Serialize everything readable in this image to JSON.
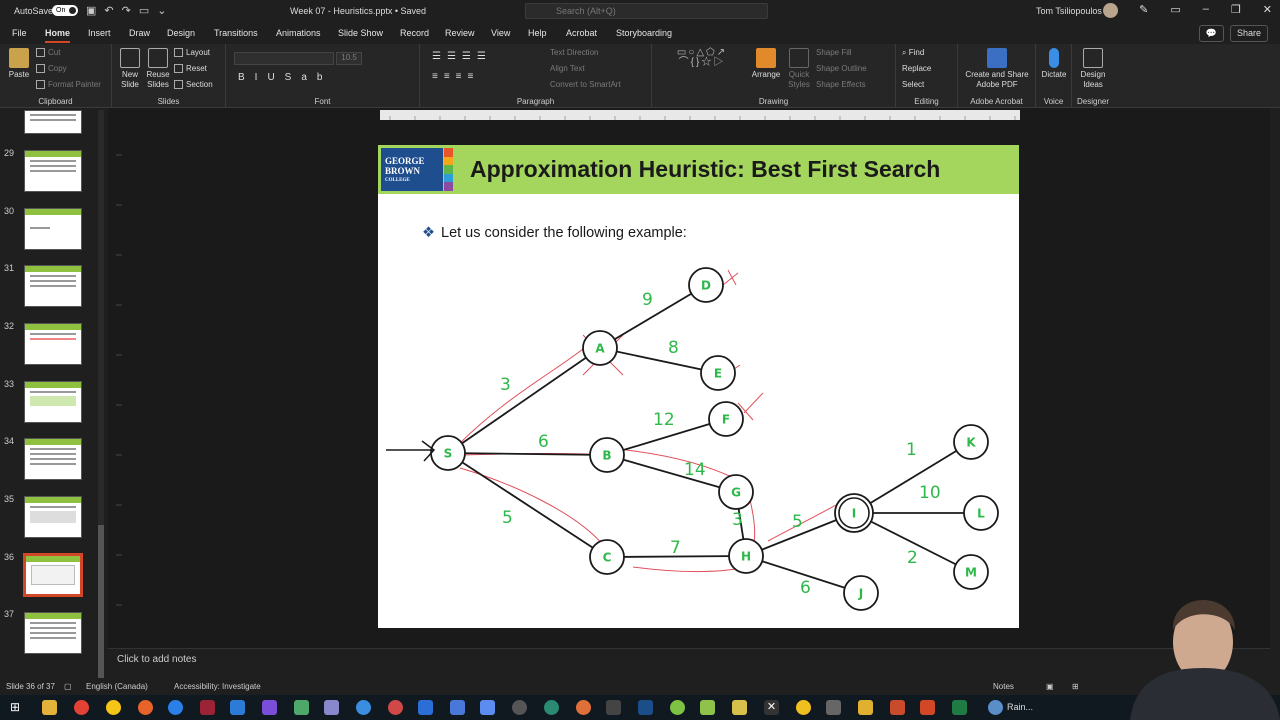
{
  "titlebar": {
    "autosave_label": "AutoSave",
    "autosave_state": "On",
    "document_title": "Week 07 - Heuristics.pptx • Saved",
    "search_placeholder": "Search (Alt+Q)",
    "user_name": "Tom Tsiliopoulos"
  },
  "menu": {
    "tabs": [
      "File",
      "Home",
      "Insert",
      "Draw",
      "Design",
      "Transitions",
      "Animations",
      "Slide Show",
      "Record",
      "Review",
      "View",
      "Help",
      "Acrobat",
      "Storyboarding"
    ],
    "active_tab": "Home",
    "share_label": "Share"
  },
  "ribbon": {
    "clipboard": {
      "label": "Clipboard",
      "paste": "Paste",
      "cut": "Cut",
      "copy": "Copy",
      "format_painter": "Format Painter"
    },
    "slides": {
      "label": "Slides",
      "new_slide": "New Slide",
      "reuse_slides": "Reuse Slides",
      "layout": "Layout",
      "reset": "Reset",
      "section": "Section"
    },
    "font": {
      "label": "Font",
      "size": "10.5"
    },
    "paragraph": {
      "label": "Paragraph",
      "text_direction": "Text Direction",
      "align_text": "Align Text",
      "convert_smartart": "Convert to SmartArt"
    },
    "drawing": {
      "label": "Drawing",
      "arrange": "Arrange",
      "quick_styles": "Quick Styles",
      "shape_fill": "Shape Fill",
      "shape_outline": "Shape Outline",
      "shape_effects": "Shape Effects"
    },
    "editing": {
      "label": "Editing",
      "find": "Find",
      "replace": "Replace",
      "select": "Select"
    },
    "acrobat": {
      "label": "Adobe Acrobat",
      "create_share": "Create and Share Adobe PDF"
    },
    "voice": {
      "label": "Voice",
      "dictate": "Dictate"
    },
    "designer": {
      "label": "Designer",
      "design_ideas": "Design Ideas"
    }
  },
  "thumbnails": {
    "numbers": [
      "29",
      "30",
      "31",
      "32",
      "33",
      "34",
      "35",
      "36",
      "37"
    ],
    "selected": "36"
  },
  "slide": {
    "logo_text_line1": "GEORGE",
    "logo_text_line2": "BROWN",
    "logo_text_line3": "COLLEGE",
    "title": "Approximation Heuristic: Best First Search",
    "bullet": "Let us consider the following example:",
    "graph": {
      "nodes": [
        "S",
        "A",
        "B",
        "C",
        "D",
        "E",
        "F",
        "G",
        "H",
        "I",
        "J",
        "K",
        "L",
        "M"
      ],
      "edges": [
        {
          "from": "S",
          "to": "A",
          "weight": "3"
        },
        {
          "from": "S",
          "to": "B",
          "weight": "6"
        },
        {
          "from": "S",
          "to": "C",
          "weight": "5"
        },
        {
          "from": "A",
          "to": "D",
          "weight": "9"
        },
        {
          "from": "A",
          "to": "E",
          "weight": "8"
        },
        {
          "from": "B",
          "to": "F",
          "weight": "12"
        },
        {
          "from": "B",
          "to": "G",
          "weight": "14"
        },
        {
          "from": "C",
          "to": "H",
          "weight": "7"
        },
        {
          "from": "H",
          "to": "G",
          "weight": "3"
        },
        {
          "from": "H",
          "to": "I",
          "weight": "5"
        },
        {
          "from": "H",
          "to": "J",
          "weight": "6"
        },
        {
          "from": "I",
          "to": "K",
          "weight": "1"
        },
        {
          "from": "I",
          "to": "L",
          "weight": "10"
        },
        {
          "from": "I",
          "to": "M",
          "weight": "2"
        }
      ]
    }
  },
  "notes": {
    "placeholder": "Click to add notes"
  },
  "status": {
    "slide_counter": "Slide 36 of 37",
    "language": "English (Canada)",
    "accessibility": "Accessibility: Investigate",
    "notes_btn": "Notes"
  },
  "taskbar": {
    "weather": "Rain..."
  },
  "colors": {
    "accent": "#d24726",
    "slide_header": "#a4d65e",
    "graph_weight": "#2fb84a",
    "annotation": "#e0505a"
  }
}
